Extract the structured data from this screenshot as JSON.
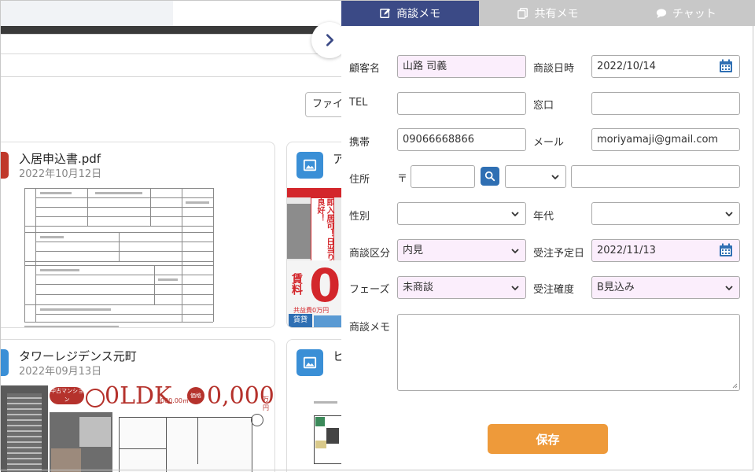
{
  "tabs": [
    {
      "label": "商談メモ",
      "icon": "edit-icon"
    },
    {
      "label": "共有メモ",
      "icon": "copy-icon"
    },
    {
      "label": "チャット",
      "icon": "chat-icon"
    }
  ],
  "form": {
    "customer_name": {
      "label": "顧客名",
      "value": "山路 司義"
    },
    "meeting_date": {
      "label": "商談日時",
      "value": "2022/10/14"
    },
    "tel": {
      "label": "TEL",
      "value": ""
    },
    "window": {
      "label": "窓口",
      "value": ""
    },
    "mobile": {
      "label": "携帯",
      "value": "09066668866"
    },
    "email": {
      "label": "メール",
      "value": "moriyamaji@gmail.com"
    },
    "address": {
      "label": "住所",
      "zip_symbol": "〒",
      "zip_value": "",
      "prefecture": "",
      "street": ""
    },
    "gender": {
      "label": "性別",
      "value": ""
    },
    "age": {
      "label": "年代",
      "value": ""
    },
    "category": {
      "label": "商談区分",
      "value": "内見"
    },
    "order_date": {
      "label": "受注予定日",
      "value": "2022/11/13"
    },
    "phase": {
      "label": "フェーズ",
      "value": "未商談"
    },
    "certainty": {
      "label": "受注確度",
      "value": "B見込み"
    },
    "memo": {
      "label": "商談メモ",
      "value": ""
    },
    "save_label": "保存"
  },
  "background": {
    "file_button": "ファイ",
    "cards": [
      {
        "title": "入居申込書.pdf",
        "date": "2022年10月12日",
        "icon": "pdf-icon"
      },
      {
        "title": "ア",
        "date": "",
        "icon": "image-icon"
      },
      {
        "title": "タワーレジデンス元町",
        "date": "2022年09月13日",
        "icon": "document-icon"
      },
      {
        "title": "ヒ",
        "date": "",
        "icon": "image-icon"
      }
    ],
    "flyer": {
      "headline": "即入居可！日当り良好！",
      "badge": "賃貸",
      "price_label": "賃料",
      "price_number": "0",
      "deposit": "共益費0万円"
    },
    "tower_ad": {
      "tag": "中古マンション",
      "layout": "0LDK",
      "area": "000.00㎡",
      "price_label": "価格",
      "price": "0,000",
      "unit": "万円"
    }
  },
  "colors": {
    "tab_active": "#3b4a86",
    "tab_inactive": "#c8c8c8",
    "save": "#ee9a3a",
    "highlight_field": "#fbeefc",
    "accent_blue": "#2f6fb3"
  }
}
